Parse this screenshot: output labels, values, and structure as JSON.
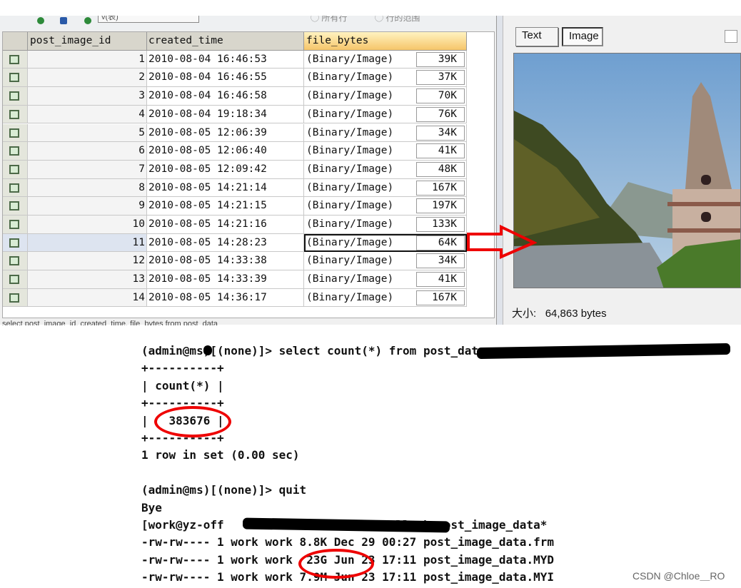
{
  "toolbar": {
    "combo_value": "v(表)",
    "radio1": "◯ 所有行",
    "radio2": "◯ 行的范围"
  },
  "grid": {
    "columns": [
      "post_image_id",
      "created_time",
      "file_bytes"
    ],
    "rows": [
      {
        "id": "1",
        "time": "2010-08-04 16:46:53",
        "bytes": "(Binary/Image)",
        "size": "39K"
      },
      {
        "id": "2",
        "time": "2010-08-04 16:46:55",
        "bytes": "(Binary/Image)",
        "size": "37K"
      },
      {
        "id": "3",
        "time": "2010-08-04 16:46:58",
        "bytes": "(Binary/Image)",
        "size": "70K"
      },
      {
        "id": "4",
        "time": "2010-08-04 19:18:34",
        "bytes": "(Binary/Image)",
        "size": "76K"
      },
      {
        "id": "5",
        "time": "2010-08-05 12:06:39",
        "bytes": "(Binary/Image)",
        "size": "34K"
      },
      {
        "id": "6",
        "time": "2010-08-05 12:06:40",
        "bytes": "(Binary/Image)",
        "size": "41K"
      },
      {
        "id": "7",
        "time": "2010-08-05 12:09:42",
        "bytes": "(Binary/Image)",
        "size": "48K"
      },
      {
        "id": "8",
        "time": "2010-08-05 14:21:14",
        "bytes": "(Binary/Image)",
        "size": "167K"
      },
      {
        "id": "9",
        "time": "2010-08-05 14:21:15",
        "bytes": "(Binary/Image)",
        "size": "197K"
      },
      {
        "id": "10",
        "time": "2010-08-05 14:21:16",
        "bytes": "(Binary/Image)",
        "size": "133K"
      },
      {
        "id": "11",
        "time": "2010-08-05 14:28:23",
        "bytes": "(Binary/Image)",
        "size": "64K"
      },
      {
        "id": "12",
        "time": "2010-08-05 14:33:38",
        "bytes": "(Binary/Image)",
        "size": "34K"
      },
      {
        "id": "13",
        "time": "2010-08-05 14:33:39",
        "bytes": "(Binary/Image)",
        "size": "41K"
      },
      {
        "id": "14",
        "time": "2010-08-05 14:36:17",
        "bytes": "(Binary/Image)",
        "size": "167K"
      }
    ],
    "selected_row": "11",
    "status": "select post_image_id, created_time, file_bytes from post_data"
  },
  "viewer": {
    "text_tab": "Text",
    "image_tab": "Image",
    "size_label": "大小:",
    "size_value": "64,863 bytes"
  },
  "terminal": {
    "lines": [
      "(admin@ms)[(none)]> select count(*) from post_data_ca",
      "+----------+",
      "| count(*) |",
      "+----------+",
      "|   383676 |",
      "+----------+",
      "1 row in set (0.00 sec)",
      "",
      "(admin@ms)[(none)]> quit",
      "Bye",
      "[work@yz-off                      ]$ ll -h post_image_data*",
      "-rw-rw---- 1 work work 8.8K Dec 29 00:27 post_image_data.frm",
      "-rw-rw---- 1 work work  23G Jun 23 17:11 post_image_data.MYD",
      "-rw-rw---- 1 work work 7.9M Jun 23 17:11 post_image_data.MYI"
    ]
  },
  "watermark": "CSDN @Chloe＿RO",
  "colors": {
    "annotation": "#e00000",
    "header_active": "#f6c56a"
  }
}
